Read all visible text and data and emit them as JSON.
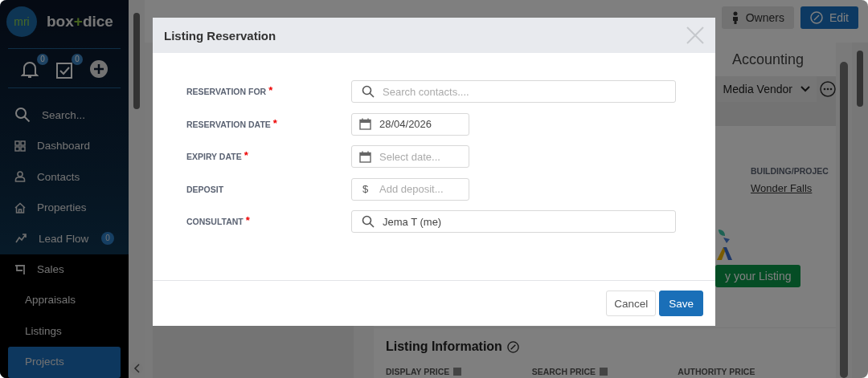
{
  "sidebar": {
    "logo_mark": "mri",
    "logo_parts": [
      "box",
      "+",
      "dice"
    ],
    "quick": [
      {
        "kind": "bell",
        "badge": "0"
      },
      {
        "kind": "tasks",
        "badge": "0"
      },
      {
        "kind": "add"
      }
    ],
    "items": [
      {
        "kind": "search",
        "label": "Search...",
        "selected": false
      },
      {
        "kind": "dashboard",
        "label": "Dashboard",
        "selected": false
      },
      {
        "kind": "contacts",
        "label": "Contacts",
        "selected": false
      },
      {
        "kind": "properties",
        "label": "Properties",
        "selected": false
      },
      {
        "kind": "leadflow",
        "label": "Lead Flow",
        "badge": "0",
        "selected": false
      },
      {
        "kind": "sales",
        "label": "Sales",
        "selected": false,
        "expanded": true,
        "children": [
          {
            "label": "Appraisals",
            "selected": false
          },
          {
            "label": "Listings",
            "selected": false
          },
          {
            "label": "Projects",
            "selected": true
          }
        ]
      }
    ]
  },
  "header": {
    "buttons": [
      {
        "kind": "owners",
        "label": "Owners"
      },
      {
        "kind": "edit",
        "label": "Edit"
      }
    ]
  },
  "listing": {
    "tab": "Accounting",
    "vendor_select": "Media Vendor",
    "building_label": "BUILDING/PROJEC",
    "building_value": "Wonder Falls",
    "promo_button": "y your Listing",
    "info_title": "Listing Information",
    "price_columns": [
      "DISPLAY PRICE",
      "SEARCH PRICE",
      "AUTHORITY PRICE"
    ]
  },
  "dialog": {
    "title": "Listing Reservation",
    "fields": [
      {
        "label": "RESERVATION FOR",
        "required_mark": "*",
        "kind": "search",
        "wide": true,
        "placeholder": "Search contacts...."
      },
      {
        "label": "RESERVATION DATE",
        "required_mark": "*",
        "kind": "date",
        "wide": false,
        "value": "28/04/2026"
      },
      {
        "label": "EXPIRY DATE",
        "required_mark": "*",
        "kind": "date",
        "wide": false,
        "placeholder": "Select date..."
      },
      {
        "label": "DEPOSIT",
        "kind": "currency",
        "prefix": "$",
        "wide": false,
        "placeholder": "Add deposit..."
      },
      {
        "label": "CONSULTANT",
        "required_mark": "*",
        "kind": "search",
        "wide": true,
        "value": "Jema T (me)"
      }
    ],
    "buttons": [
      {
        "label": "Cancel",
        "kind": "secondary"
      },
      {
        "label": "Save",
        "kind": "primary"
      }
    ]
  }
}
